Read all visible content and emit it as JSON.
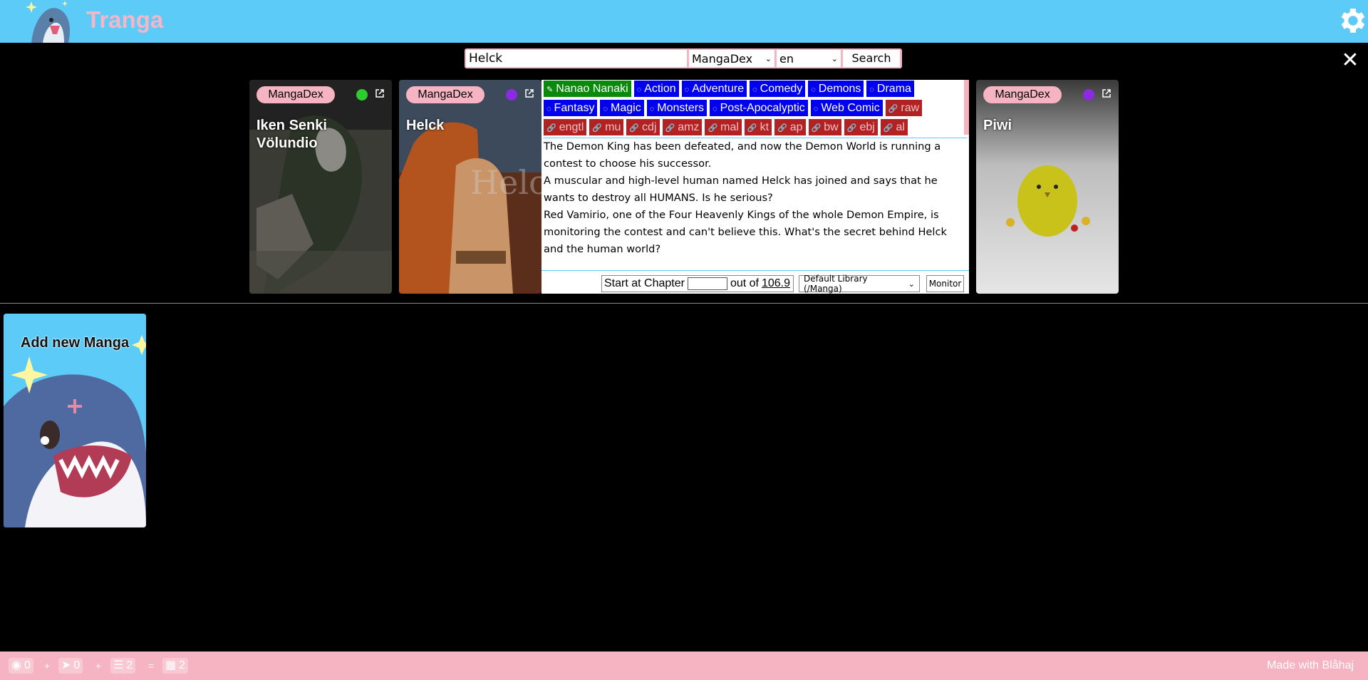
{
  "header": {
    "title": "Tranga"
  },
  "search": {
    "query": "Helck",
    "site": "MangaDex",
    "language": "en",
    "button_label": "Search"
  },
  "results": [
    {
      "site": "MangaDex",
      "title": "Iken Senki Völundio",
      "status_color": "#2ecc2e"
    },
    {
      "site": "MangaDex",
      "title": "Helck",
      "status_color": "#8a2be2"
    },
    {
      "site": "MangaDex",
      "title": "Piwi",
      "status_color": "#8a2be2"
    }
  ],
  "detail": {
    "author_tag": "Nanao Nanaki",
    "genre_tags": [
      "Action",
      "Adventure",
      "Comedy",
      "Demons",
      "Drama",
      "Fantasy",
      "Magic",
      "Monsters",
      "Post-Apocalyptic",
      "Web Comic"
    ],
    "link_tags": [
      "raw",
      "engtl",
      "mu",
      "cdj",
      "amz",
      "mal",
      "kt",
      "ap",
      "bw",
      "ebj",
      "al"
    ],
    "description": [
      "The Demon King has been defeated, and now the Demon World is running a contest to choose his successor.",
      "A muscular and high-level human named Helck has joined and says that he wants to destroy all HUMANS. Is he serious?",
      "Red Vamirio, one of the Four Heavenly Kings of the whole Demon Empire, is monitoring the contest and can't believe this. What's the secret behind Helck and the human world?"
    ],
    "start_label": "Start at Chapter",
    "out_of_label": "out of",
    "max_chapter": "106.9",
    "library": "Default Library (/Manga)",
    "monitor_label": "Monitor"
  },
  "add_card": {
    "label": "Add new Manga"
  },
  "footer": {
    "monitoring": "0",
    "running": "0",
    "queued": "2",
    "total": "2",
    "made_with": "Made with Blåhaj"
  }
}
